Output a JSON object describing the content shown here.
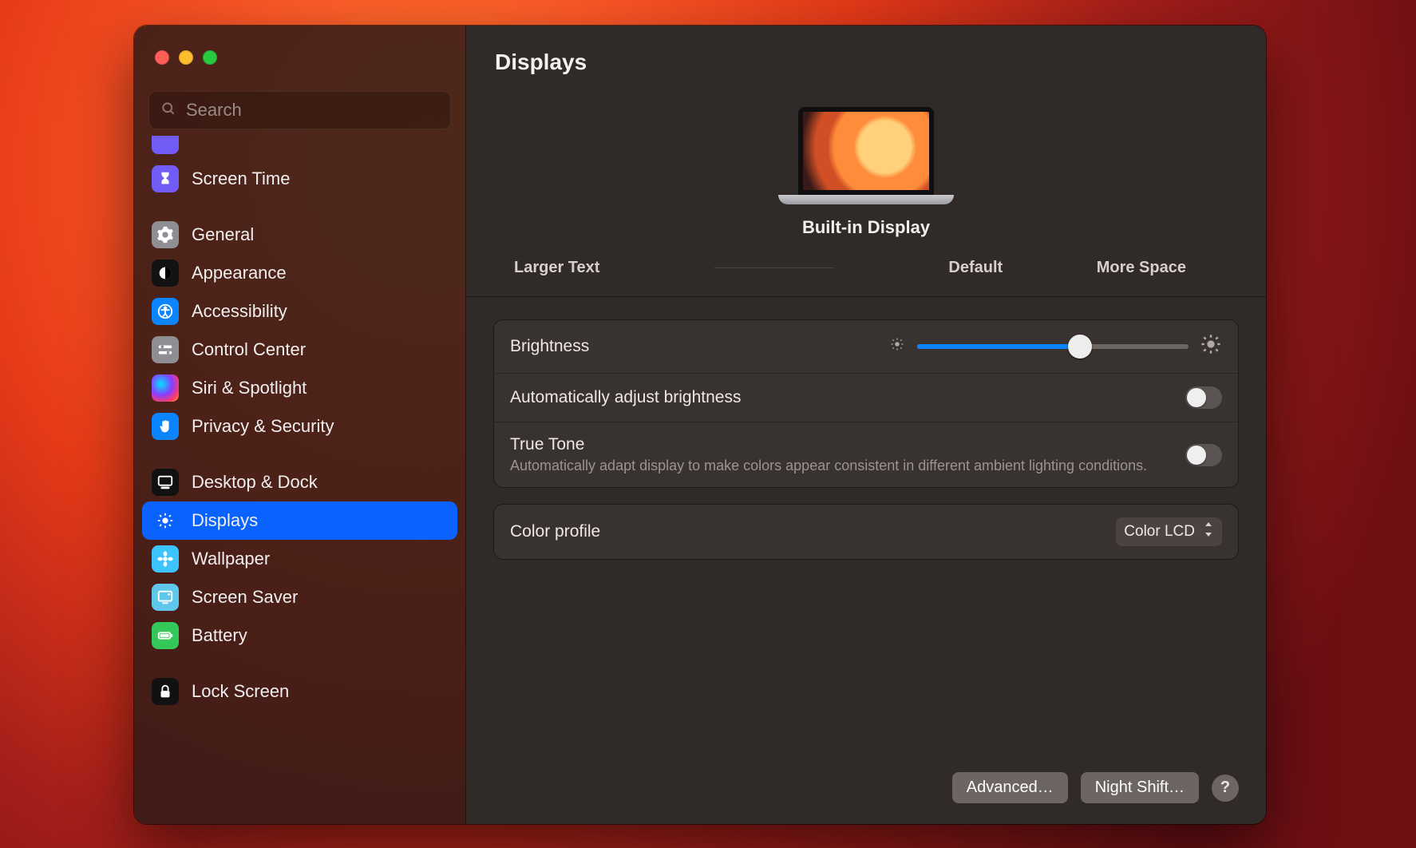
{
  "window": {
    "title": "Displays"
  },
  "search": {
    "placeholder": "Search",
    "value": ""
  },
  "sidebar": {
    "items": [
      {
        "label": "Screen Time",
        "icon": "hourglass-icon",
        "color": "purple"
      },
      {
        "label": "General",
        "icon": "gear-icon",
        "color": "gray"
      },
      {
        "label": "Appearance",
        "icon": "appearance-icon",
        "color": "black"
      },
      {
        "label": "Accessibility",
        "icon": "accessibility-icon",
        "color": "blue"
      },
      {
        "label": "Control Center",
        "icon": "switches-icon",
        "color": "gray"
      },
      {
        "label": "Siri & Spotlight",
        "icon": "siri-icon",
        "color": "siri"
      },
      {
        "label": "Privacy & Security",
        "icon": "hand-icon",
        "color": "blue"
      },
      {
        "label": "Desktop & Dock",
        "icon": "dock-icon",
        "color": "dark"
      },
      {
        "label": "Displays",
        "icon": "brightness-icon",
        "color": "lblue",
        "selected": true
      },
      {
        "label": "Wallpaper",
        "icon": "flower-icon",
        "color": "cyan"
      },
      {
        "label": "Screen Saver",
        "icon": "screensaver-icon",
        "color": "ltblue"
      },
      {
        "label": "Battery",
        "icon": "battery-icon",
        "color": "green"
      },
      {
        "label": "Lock Screen",
        "icon": "lock-icon",
        "color": "dark"
      }
    ]
  },
  "hero": {
    "device_name": "Built-in Display",
    "resolution": {
      "larger": "Larger Text",
      "default": "Default",
      "more": "More Space"
    }
  },
  "settings": {
    "brightness": {
      "label": "Brightness",
      "value_percent": 60
    },
    "auto_brightness": {
      "label": "Automatically adjust brightness",
      "value": false
    },
    "true_tone": {
      "label": "True Tone",
      "description": "Automatically adapt display to make colors appear consistent in different ambient lighting conditions.",
      "value": false
    },
    "color_profile": {
      "label": "Color profile",
      "selected": "Color LCD"
    }
  },
  "footer": {
    "advanced": "Advanced…",
    "night_shift": "Night Shift…",
    "help": "?"
  },
  "colors": {
    "accent": "#0a84ff",
    "selection": "#0a63ff"
  }
}
